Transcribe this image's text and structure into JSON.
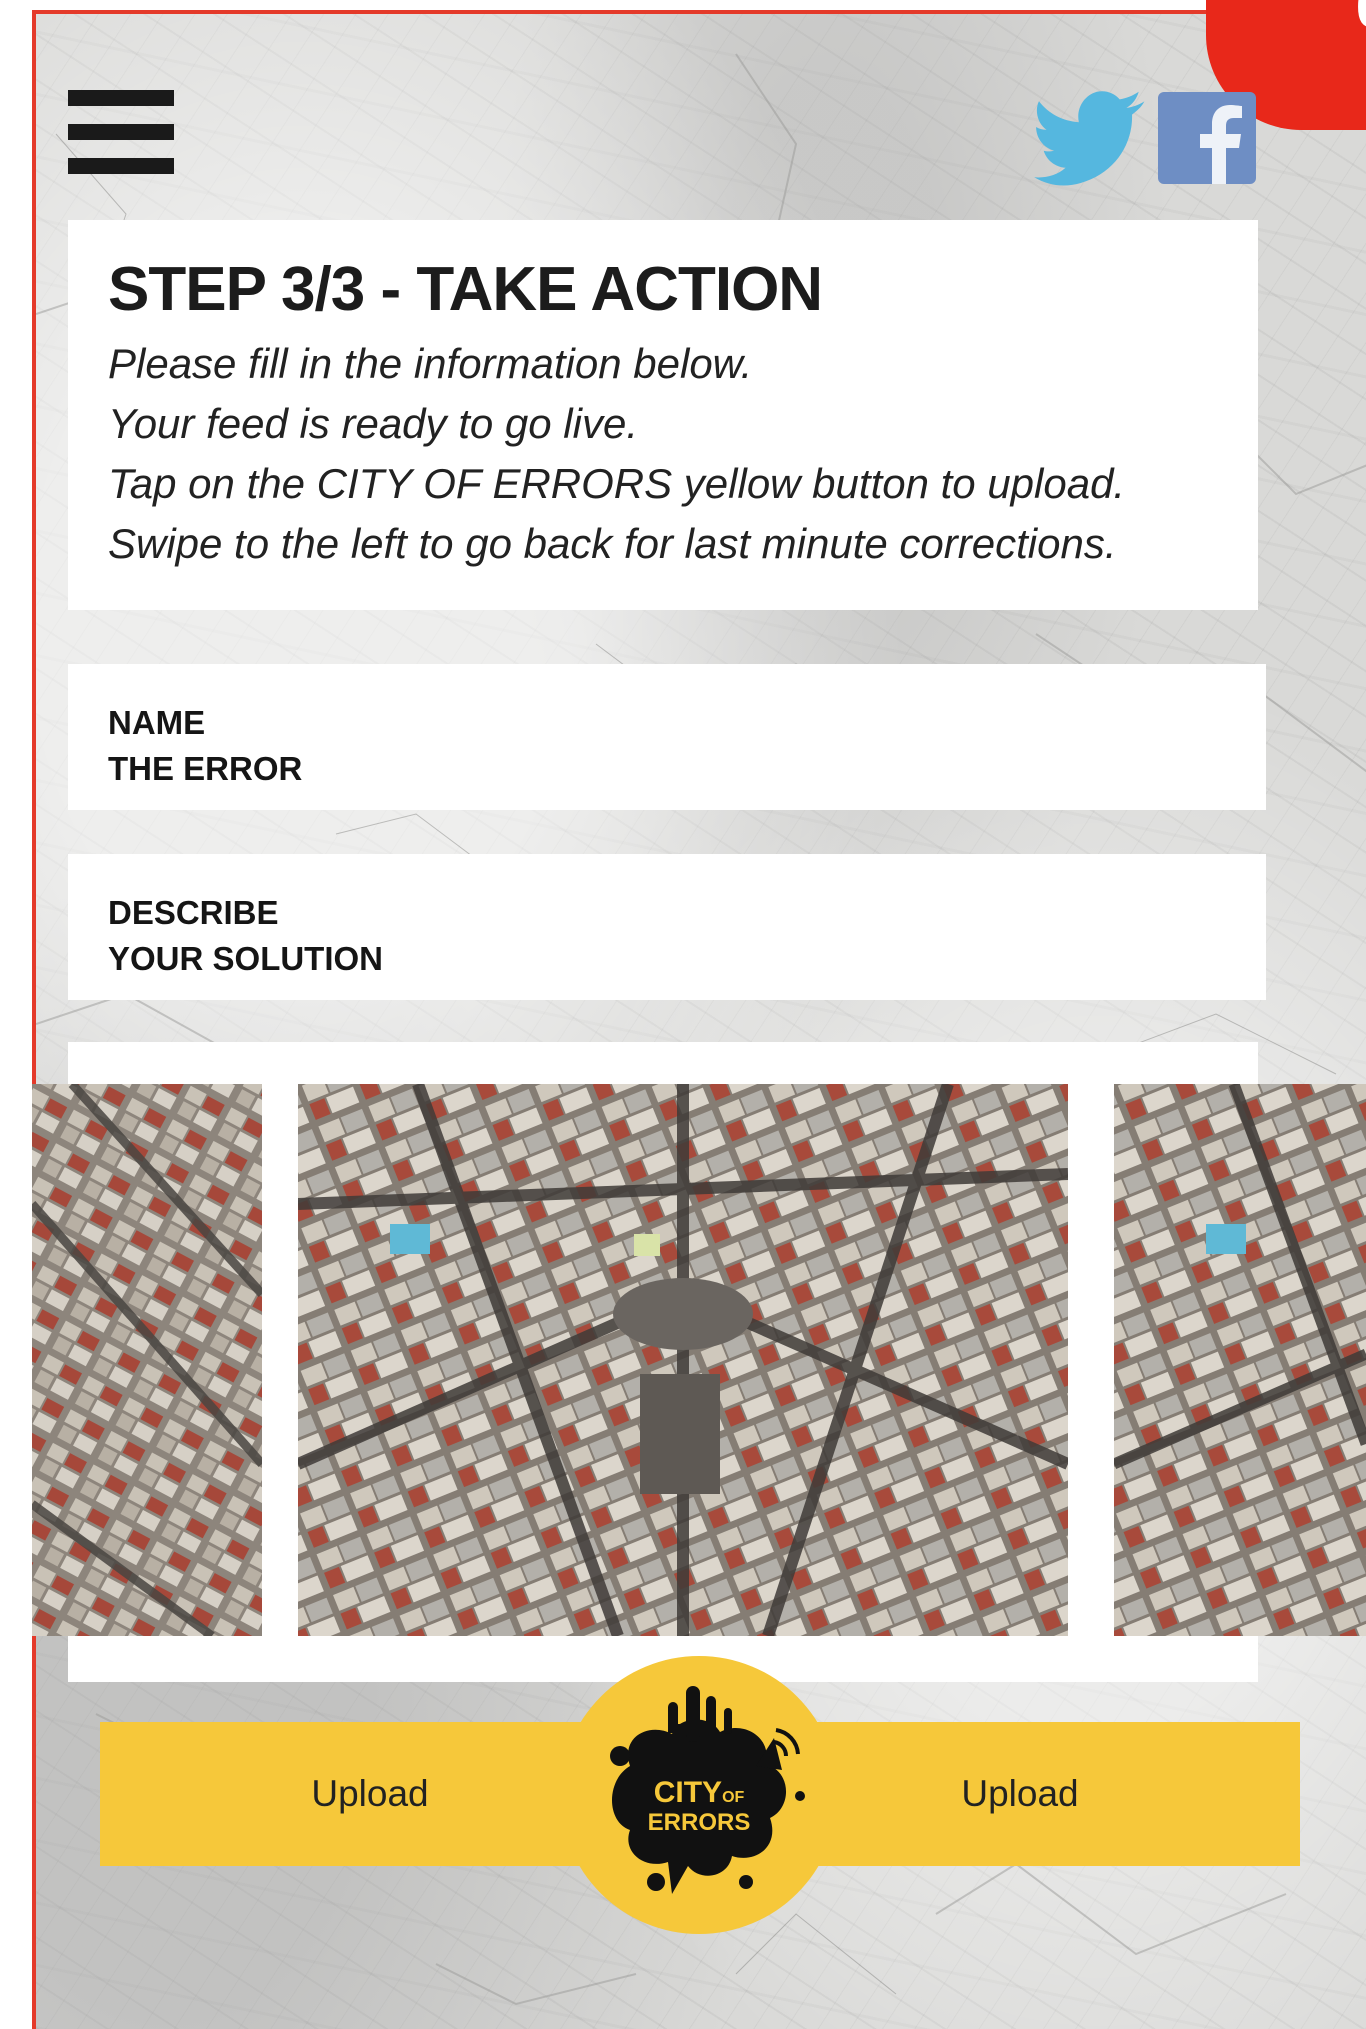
{
  "header": {
    "menu_icon": "hamburger-menu-icon",
    "social": [
      {
        "name": "twitter",
        "icon": "twitter-bird-icon",
        "color": "#55b7df"
      },
      {
        "name": "facebook",
        "icon": "facebook-f-icon",
        "color": "#6e8ec4"
      }
    ],
    "corner_badge_color": "#e8281a"
  },
  "intro": {
    "title": "STEP 3/3 - TAKE ACTION",
    "lines": [
      "Please fill in the information below.",
      "Your feed is ready to go live.",
      "Tap on the CITY OF ERRORS yellow button to upload.",
      "Swipe to the left to go back for last minute corrections."
    ]
  },
  "form": {
    "name_field": {
      "label_line1": "NAME",
      "label_line2": "THE ERROR"
    },
    "solution_field": {
      "label_line1": "DESCRIBE",
      "label_line2": "YOUR SOLUTION"
    }
  },
  "gallery": {
    "images": [
      "aerial-city-photo",
      "aerial-city-photo",
      "aerial-city-photo"
    ]
  },
  "actions": {
    "upload_left": "Upload",
    "upload_right": "Upload",
    "logo_line1": "CITY",
    "logo_of": "OF",
    "logo_line2": "ERRORS",
    "accent": "#f6c83a"
  }
}
